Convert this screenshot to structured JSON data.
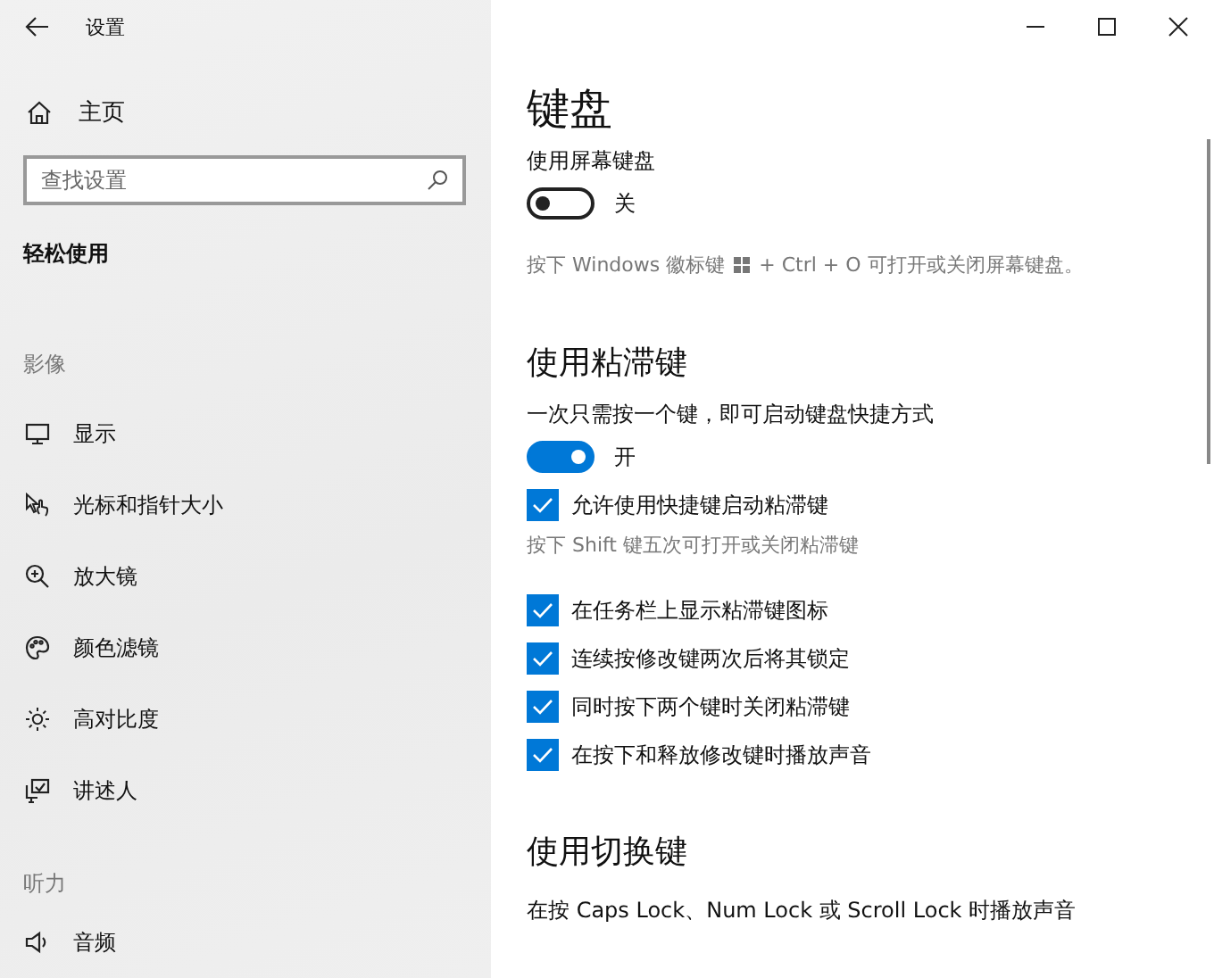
{
  "window": {
    "title": "设置"
  },
  "sidebar": {
    "home": {
      "label": "主页"
    },
    "search": {
      "placeholder": "查找设置"
    },
    "section_title": "轻松使用",
    "groups": [
      {
        "heading": "影像",
        "items": [
          {
            "label": "显示",
            "selected": false
          },
          {
            "label": "光标和指针大小",
            "selected": false
          },
          {
            "label": "放大镜",
            "selected": false
          },
          {
            "label": "颜色滤镜",
            "selected": false
          },
          {
            "label": "高对比度",
            "selected": false
          },
          {
            "label": "讲述人",
            "selected": false
          }
        ]
      },
      {
        "heading": "听力",
        "items": [
          {
            "label": "音频",
            "selected": false
          }
        ]
      }
    ]
  },
  "main": {
    "title": "键盘",
    "sections": [
      {
        "label": "使用屏幕键盘",
        "toggle": {
          "on": false,
          "state_label": "关"
        },
        "hint_before": "按下 Windows 徽标键",
        "hint_after": "+ Ctrl + O 可打开或关闭屏幕键盘。"
      },
      {
        "heading": "使用粘滞键",
        "label": "一次只需按一个键，即可启动键盘快捷方式",
        "toggle": {
          "on": true,
          "state_label": "开"
        },
        "options": [
          {
            "kind": "checkbox",
            "label": "允许使用快捷键启动粘滞键",
            "checked": true
          },
          {
            "kind": "hint",
            "label": "按下 Shift 键五次可打开或关闭粘滞键"
          },
          {
            "kind": "checkbox",
            "label": "在任务栏上显示粘滞键图标",
            "checked": true
          },
          {
            "kind": "checkbox",
            "label": "连续按修改键两次后将其锁定",
            "checked": true
          },
          {
            "kind": "checkbox",
            "label": "同时按下两个键时关闭粘滞键",
            "checked": true
          },
          {
            "kind": "checkbox",
            "label": "在按下和释放修改键时播放声音",
            "checked": true
          }
        ]
      },
      {
        "heading": "使用切换键",
        "label": "在按 Caps Lock、Num Lock 或 Scroll Lock 时播放声音"
      }
    ]
  }
}
